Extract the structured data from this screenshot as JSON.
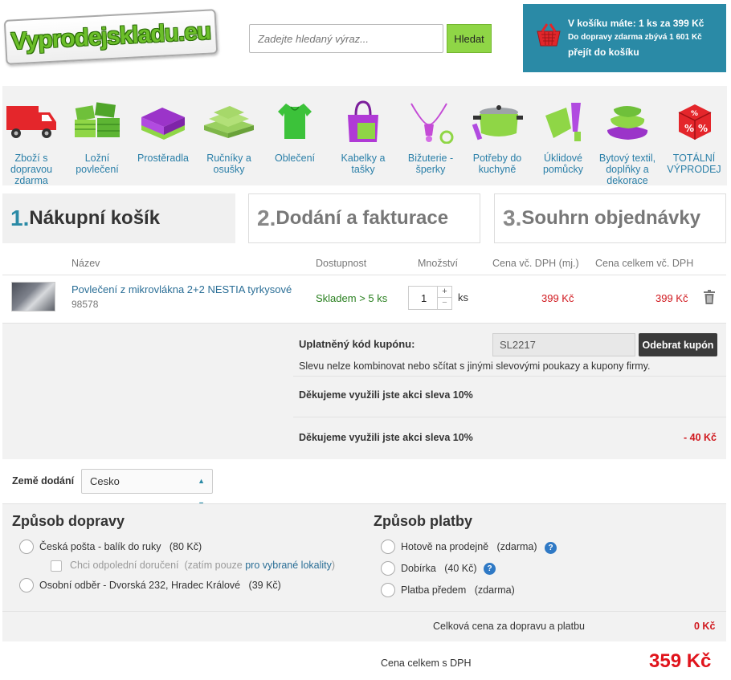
{
  "header": {
    "logo_text": "Vyprodejskladu.eu",
    "search_placeholder": "Zadejte hledaný výraz...",
    "search_button": "Hledat"
  },
  "cart": {
    "line1": "V košíku máte: 1 ks za 399 Kč",
    "line2": "Do dopravy zdarma zbývá 1 601 Kč",
    "line3": "přejít do košíku"
  },
  "categories": [
    {
      "label": "Zboží s dopravou zdarma",
      "icon": "truck-icon"
    },
    {
      "label": "Ložní povlečení",
      "icon": "bedding-icon"
    },
    {
      "label": "Prostěradla",
      "icon": "sheets-icon"
    },
    {
      "label": "Ručníky a osušky",
      "icon": "towels-icon"
    },
    {
      "label": "Oblečení",
      "icon": "clothes-icon"
    },
    {
      "label": "Kabelky a tašky",
      "icon": "handbag-icon"
    },
    {
      "label": "Bižuterie - šperky",
      "icon": "jewelry-icon"
    },
    {
      "label": "Potřeby do kuchyně",
      "icon": "kitchen-pot-icon"
    },
    {
      "label": "Úklidové pomůcky",
      "icon": "cleaning-icon"
    },
    {
      "label": "Bytový textil, doplňky a dekorace",
      "icon": "pillows-icon"
    },
    {
      "label": "TOTÁLNÍ VÝPRODEJ",
      "icon": "sale-dice-icon"
    }
  ],
  "steps": [
    {
      "num": "1.",
      "label": "Nákupní košík"
    },
    {
      "num": "2.",
      "label": "Dodání a fakturace"
    },
    {
      "num": "3.",
      "label": "Souhrn objednávky"
    }
  ],
  "table": {
    "headers": {
      "name": "Název",
      "availability": "Dostupnost",
      "quantity": "Množství",
      "unit_price": "Cena vč. DPH (mj.)",
      "total_price": "Cena celkem vč. DPH"
    },
    "item": {
      "name": "Povlečení z mikrovlákna 2+2 NESTIA tyrkysové",
      "code": "98578",
      "availability": "Skladem > 5 ks",
      "quantity": "1",
      "unit": "ks",
      "unit_price": "399 Kč",
      "total_price": "399 Kč"
    }
  },
  "coupon": {
    "label": "Uplatněný kód kupónu:",
    "code": "SL2217",
    "remove_button": "Odebrat kupón",
    "note": "Slevu nelze kombinovat nebo sčítat s jinými slevovými poukazy a kupony firmy.",
    "thanks1": "Děkujeme využili jste akci sleva 10%",
    "thanks2": "Děkujeme využili jste akci sleva 10%",
    "discount": "- 40 Kč"
  },
  "country": {
    "label": "Země dodání",
    "selected": "Cesko"
  },
  "shipping": {
    "title": "Způsob dopravy",
    "opt1_name": "Česká pošta - balík do ruky",
    "opt1_price": "(80 Kč)",
    "opt1_check_label": "Chci odpolední doručení",
    "opt1_check_note_a": "(zatím pouze ",
    "opt1_check_link": "pro vybrané lokality",
    "opt1_check_note_b": ")",
    "opt2_name": "Osobní odběr - Dvorská 232, Hradec Králové",
    "opt2_price": "(39 Kč)"
  },
  "payment": {
    "title": "Způsob platby",
    "opt1_name": "Hotově na prodejně",
    "opt1_price": "(zdarma)",
    "opt2_name": "Dobírka",
    "opt2_price": "(40 Kč)",
    "opt3_name": "Platba předem",
    "opt3_price": "(zdarma)"
  },
  "totals": {
    "ship_label": "Celková cena za dopravu a platbu",
    "ship_value": "0 Kč",
    "grand_label": "Cena celkem s DPH",
    "grand_value": "359 Kč"
  },
  "colors": {
    "accent_teal": "#2a8aa6",
    "price_red": "#d0181e",
    "search_green": "#8fd646",
    "stock_green": "#2a8020"
  }
}
